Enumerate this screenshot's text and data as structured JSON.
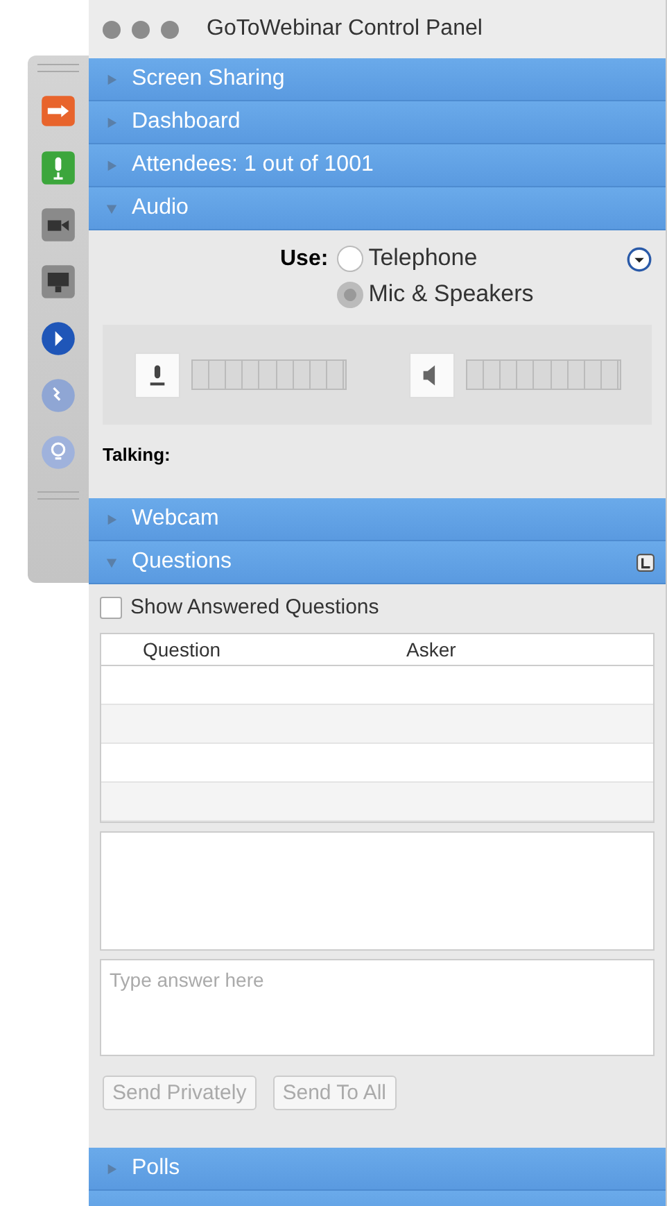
{
  "window": {
    "title": "GoToWebinar Control Panel"
  },
  "sections": [
    {
      "kind": "header",
      "label": "Screen Sharing",
      "expanded": false
    },
    {
      "kind": "header",
      "label": "Dashboard",
      "expanded": false
    },
    {
      "kind": "header",
      "label": "Attendees: 1 out of 1001",
      "expanded": false
    },
    {
      "kind": "audio",
      "label": "Audio",
      "expanded": true,
      "use_label": "Use:",
      "options": [
        {
          "label": "Telephone",
          "selected": false
        },
        {
          "label": "Mic & Speakers",
          "selected": true
        }
      ],
      "meters": [
        {
          "kind": "mic"
        },
        {
          "kind": "speaker"
        }
      ],
      "talking_label": "Talking:"
    },
    {
      "kind": "header",
      "label": "Webcam",
      "expanded": false
    },
    {
      "kind": "questions",
      "label": "Questions",
      "expanded": true,
      "show_answered": {
        "label": "Show Answered Questions",
        "checked": false
      },
      "columns": [
        "Question",
        "Asker"
      ],
      "answer": {
        "placeholder": "Type answer here"
      },
      "buttons": [
        {
          "label": "Send Privately",
          "disabled": true
        },
        {
          "label": "Send To All",
          "disabled": true
        }
      ]
    },
    {
      "kind": "header",
      "label": "Polls",
      "expanded": false
    },
    {
      "kind": "header"
    }
  ]
}
